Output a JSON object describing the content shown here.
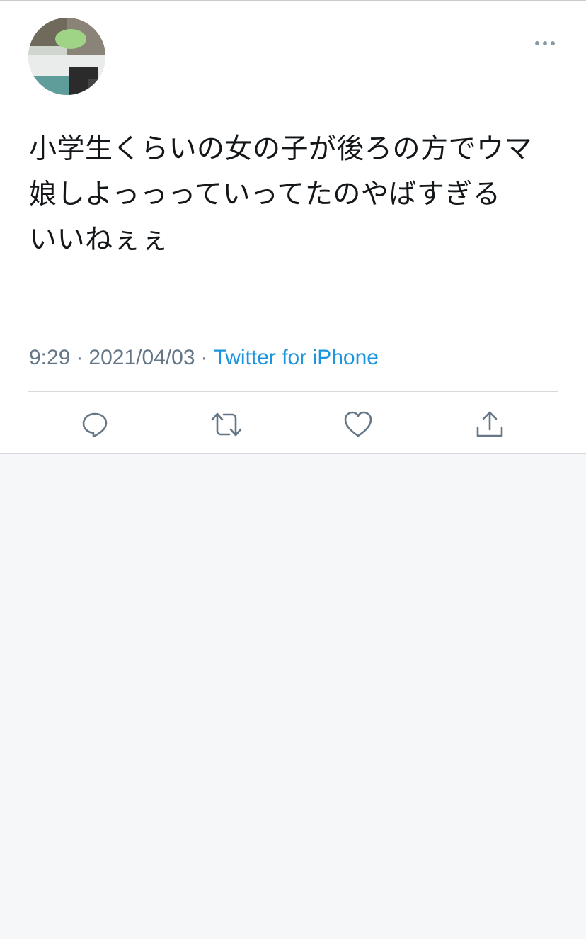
{
  "tweet": {
    "author": {
      "name": " ",
      "handle": " "
    },
    "text": "小学生くらいの女の子が後ろの方でウマ娘しよっっっていってたのやばすぎる\nいいねぇぇ",
    "time": "9:29",
    "separator": "·",
    "date": "2021/04/03",
    "source": "Twitter for iPhone"
  },
  "icons": {
    "more": "more-horizontal-icon",
    "reply": "reply-icon",
    "retweet": "retweet-icon",
    "like": "heart-icon",
    "share": "share-icon"
  },
  "colors": {
    "text": "#14171a",
    "secondary": "#657786",
    "link": "#1b95e0",
    "background": "#f5f7f9"
  }
}
